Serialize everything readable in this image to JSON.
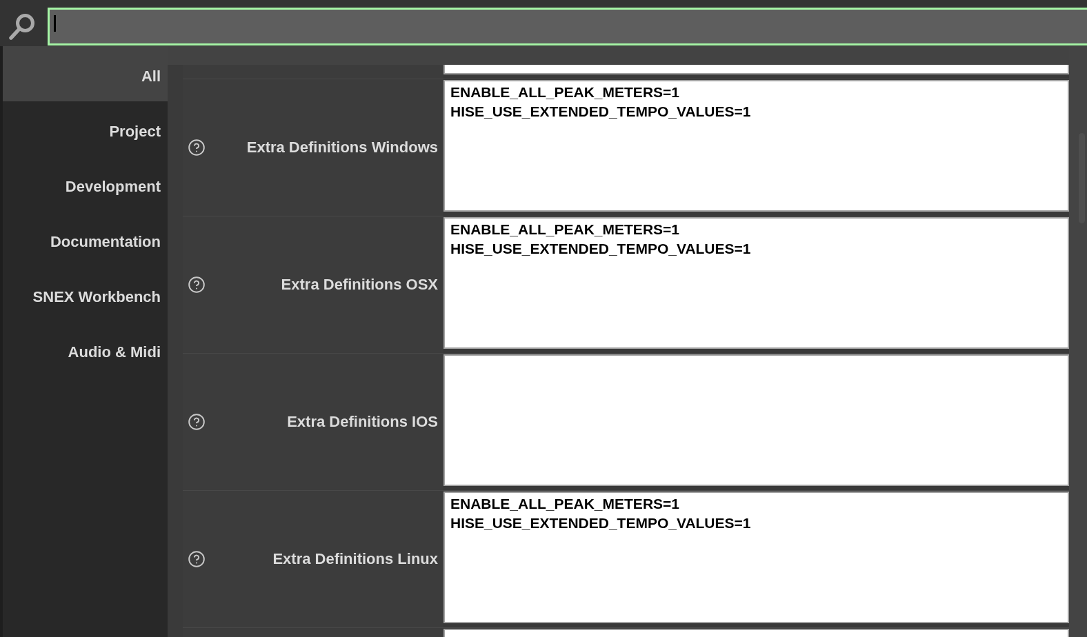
{
  "search": {
    "focused": true
  },
  "sidebar": {
    "items": [
      {
        "label": "All",
        "selected": true
      },
      {
        "label": "Project",
        "selected": false
      },
      {
        "label": "Development",
        "selected": false
      },
      {
        "label": "Documentation",
        "selected": false
      },
      {
        "label": "SNEX Workbench",
        "selected": false
      },
      {
        "label": "Audio & Midi",
        "selected": false
      }
    ]
  },
  "settings": {
    "rows": [
      {
        "kind": "clipped"
      },
      {
        "kind": "setting",
        "label": "Extra Definitions Windows",
        "value": "ENABLE_ALL_PEAK_METERS=1\nHISE_USE_EXTENDED_TEMPO_VALUES=1"
      },
      {
        "kind": "setting",
        "label": "Extra Definitions OSX",
        "value": "ENABLE_ALL_PEAK_METERS=1\nHISE_USE_EXTENDED_TEMPO_VALUES=1"
      },
      {
        "kind": "setting",
        "label": "Extra Definitions IOS"
      },
      {
        "kind": "setting",
        "label": "Extra Definitions Linux",
        "value": "ENABLE_ALL_PEAK_METERS=1\nHISE_USE_EXTENDED_TEMPO_VALUES=1"
      },
      {
        "kind": "clipped"
      }
    ]
  }
}
